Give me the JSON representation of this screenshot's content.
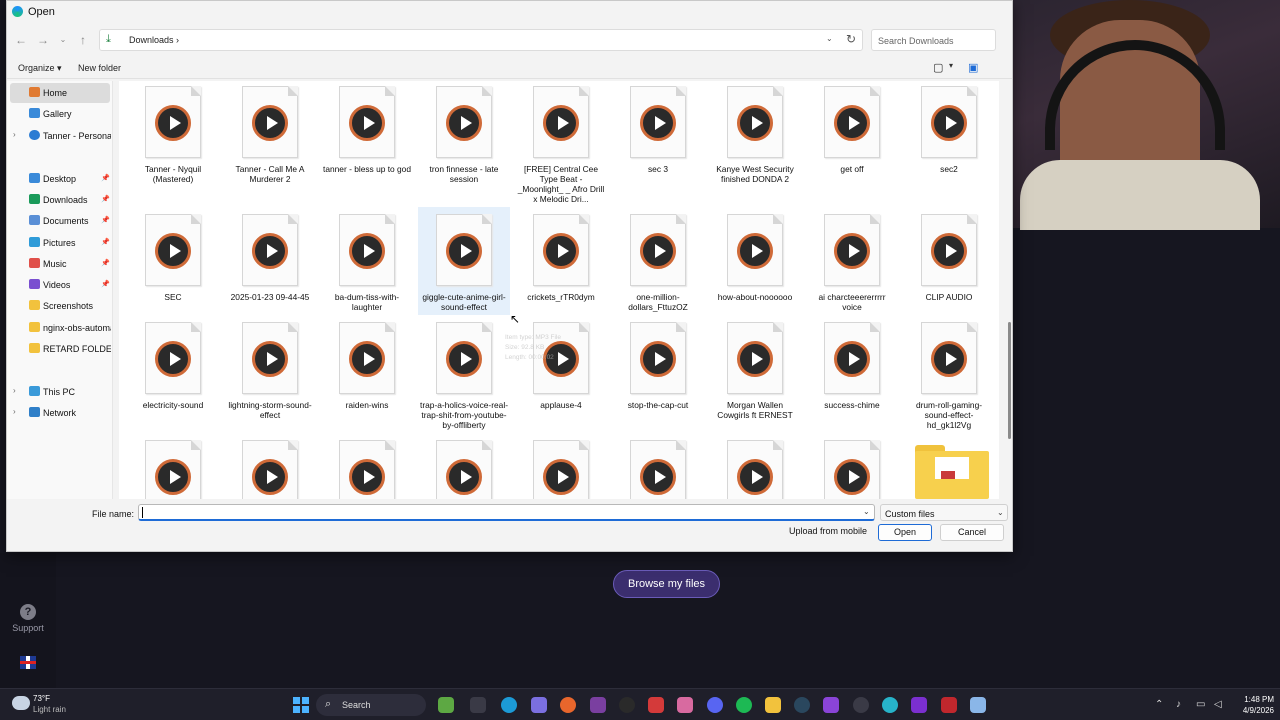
{
  "dialog": {
    "title": "Open",
    "address": {
      "breadcrumb": "Downloads",
      "separator": "›"
    },
    "search_placeholder": "Search Downloads",
    "toolbar": {
      "organize": "Organize ▾",
      "new_folder": "New folder"
    },
    "sidebar": [
      {
        "label": "Home",
        "icon": "home-icon",
        "selected": true
      },
      {
        "label": "Gallery",
        "icon": "gallery-icon"
      },
      {
        "label": "Tanner - Personal",
        "icon": "onedrive-icon",
        "expandable": true
      },
      {
        "label": "Desktop",
        "icon": "desktop-icon",
        "pinned": true
      },
      {
        "label": "Downloads",
        "icon": "downloads-icon",
        "pinned": true
      },
      {
        "label": "Documents",
        "icon": "documents-icon",
        "pinned": true
      },
      {
        "label": "Pictures",
        "icon": "pictures-icon",
        "pinned": true
      },
      {
        "label": "Music",
        "icon": "music-icon",
        "pinned": true
      },
      {
        "label": "Videos",
        "icon": "videos-icon",
        "pinned": true
      },
      {
        "label": "Screenshots",
        "icon": "folder-icon"
      },
      {
        "label": "nginx-obs-automat",
        "icon": "folder-icon"
      },
      {
        "label": "RETARD FOLDER",
        "icon": "folder-icon"
      },
      {
        "label": "This PC",
        "icon": "pc-icon",
        "expandable": true
      },
      {
        "label": "Network",
        "icon": "network-icon",
        "expandable": true
      }
    ],
    "files": [
      [
        "Tanner - Nyquil (Mastered)",
        "Tanner - Call Me A Murderer 2",
        "tanner - bless up to god",
        "tron finnesse - late session",
        "[FREE] Central Cee Type Beat - _Moonlight_ _ Afro Drill x Melodic Dri...",
        "sec 3",
        "Kanye West  Security finished  DONDA 2",
        "get off",
        "sec2"
      ],
      [
        "SEC",
        "2025-01-23 09-44-45",
        "ba-dum-tiss-with-laughter",
        "giggle-cute-anime-girl-sound-effect",
        "crickets_rTR0dym",
        "one-million-dollars_FttuzOZ",
        "how-about-noooooo",
        "ai charcteeererrrrr voice",
        "CLIP AUDIO"
      ],
      [
        "electricity-sound",
        "lightning-storm-sound-effect",
        "raiden-wins",
        "trap-a-holics-voice-real-trap-shit-from-youtube-by-offliberty",
        "applause-4",
        "stop-the-cap-cut",
        "Morgan Wallen Cowgirls ft ERNEST",
        "success-chime",
        "drum-roll-gaming-sound-effect-hd_gk1l2Vg"
      ],
      [
        "",
        "",
        "",
        "",
        "",
        "",
        "",
        "",
        ""
      ]
    ],
    "tooltip": [
      "Item type: MP3 File",
      "Size: 92.8 KB",
      "Length: 00:00:02"
    ],
    "file_name_label": "File name:",
    "file_name_value": "",
    "file_type": "Custom files",
    "buttons": {
      "upload": "Upload from mobile",
      "open": "Open",
      "cancel": "Cancel"
    }
  },
  "page": {
    "browse_button": "Browse my files",
    "support_label": "Support"
  },
  "taskbar": {
    "weather_temp": "73°F",
    "weather_desc": "Light rain",
    "search_label": "Search",
    "time": "1:48 PM",
    "date": "4/9/2026"
  },
  "colors": {
    "accent": "#1e6bd6",
    "play_ring": "#cf6a38",
    "folder": "#f7d04d",
    "browse_btn": "#3b2e6e"
  }
}
